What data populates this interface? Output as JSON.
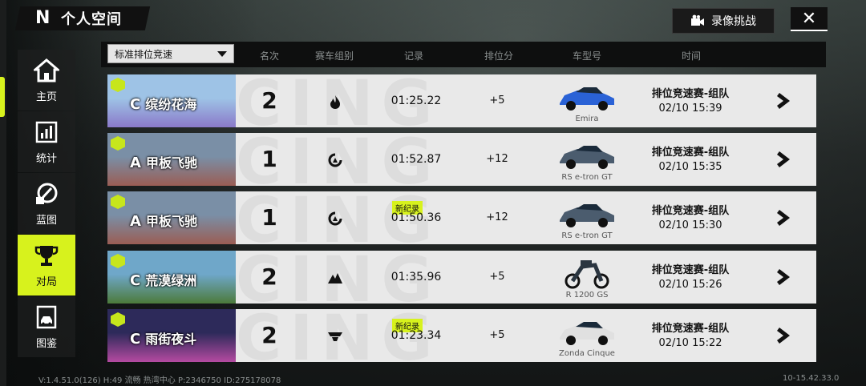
{
  "header": {
    "logo": "N",
    "title": "个人空间",
    "record_button": "录像挑战",
    "close_symbol": "✕"
  },
  "sidebar": {
    "items": [
      {
        "label": "主页",
        "icon": "home-icon"
      },
      {
        "label": "统计",
        "icon": "stats-icon"
      },
      {
        "label": "蓝图",
        "icon": "blueprint-icon"
      },
      {
        "label": "对局",
        "icon": "trophy-icon",
        "active": true
      },
      {
        "label": "图鉴",
        "icon": "catalog-icon"
      }
    ]
  },
  "table": {
    "filter_value": "标准排位竞速",
    "columns": [
      "名次",
      "赛车组别",
      "记录",
      "排位分",
      "车型号",
      "时间"
    ],
    "new_record_label": "新纪录",
    "rows": [
      {
        "grade": "C",
        "track": "缤纷花海",
        "rank": "2",
        "group_icon": "flame-icon",
        "time": "01:25.22",
        "new_record": false,
        "points": "+5",
        "car": "Emira",
        "car_color": "#2a62d6",
        "mode": "排位竞速赛-组队",
        "date": "02/10 15:39",
        "thumb_colors": [
          "#9ec3e6",
          "#8a79c9"
        ]
      },
      {
        "grade": "A",
        "track": "甲板飞驰",
        "rank": "1",
        "group_icon": "swirl-icon",
        "time": "01:52.87",
        "new_record": false,
        "points": "+12",
        "car": "RS e-tron GT",
        "car_color": "#4b5c6e",
        "mode": "排位竞速赛-组队",
        "date": "02/10 15:35",
        "thumb_colors": [
          "#7a8fa6",
          "#9a5d54"
        ]
      },
      {
        "grade": "A",
        "track": "甲板飞驰",
        "rank": "1",
        "group_icon": "swirl-icon",
        "time": "01:50.36",
        "new_record": true,
        "points": "+12",
        "car": "RS e-tron GT",
        "car_color": "#4b5c6e",
        "mode": "排位竞速赛-组队",
        "date": "02/10 15:30",
        "thumb_colors": [
          "#7a8fa6",
          "#9a5d54"
        ]
      },
      {
        "grade": "C",
        "track": "荒漠绿洲",
        "rank": "2",
        "group_icon": "mountain-icon",
        "time": "01:35.96",
        "new_record": false,
        "points": "+5",
        "car": "R 1200 GS",
        "car_color": "#2a3540",
        "mode": "排位竞速赛-组队",
        "date": "02/10 15:26",
        "thumb_colors": [
          "#6fa7c9",
          "#4c7a3a"
        ]
      },
      {
        "grade": "C",
        "track": "雨街夜斗",
        "rank": "2",
        "group_icon": "wing-icon",
        "time": "01:23.34",
        "new_record": true,
        "points": "+5",
        "car": "Zonda Cinque",
        "car_color": "#e0e0e0",
        "mode": "排位竞速赛-组队",
        "date": "02/10 15:22",
        "thumb_colors": [
          "#2d2a5a",
          "#b44aa1"
        ]
      }
    ]
  },
  "footer": {
    "left": "V:1.4.51.0(126) H:49 流畅 热湾中心 P:2346750 ID:275178078",
    "right": "10-15.42.33.0"
  },
  "colors": {
    "accent": "#d7f21d",
    "row_bg": "#e9e9e9"
  }
}
